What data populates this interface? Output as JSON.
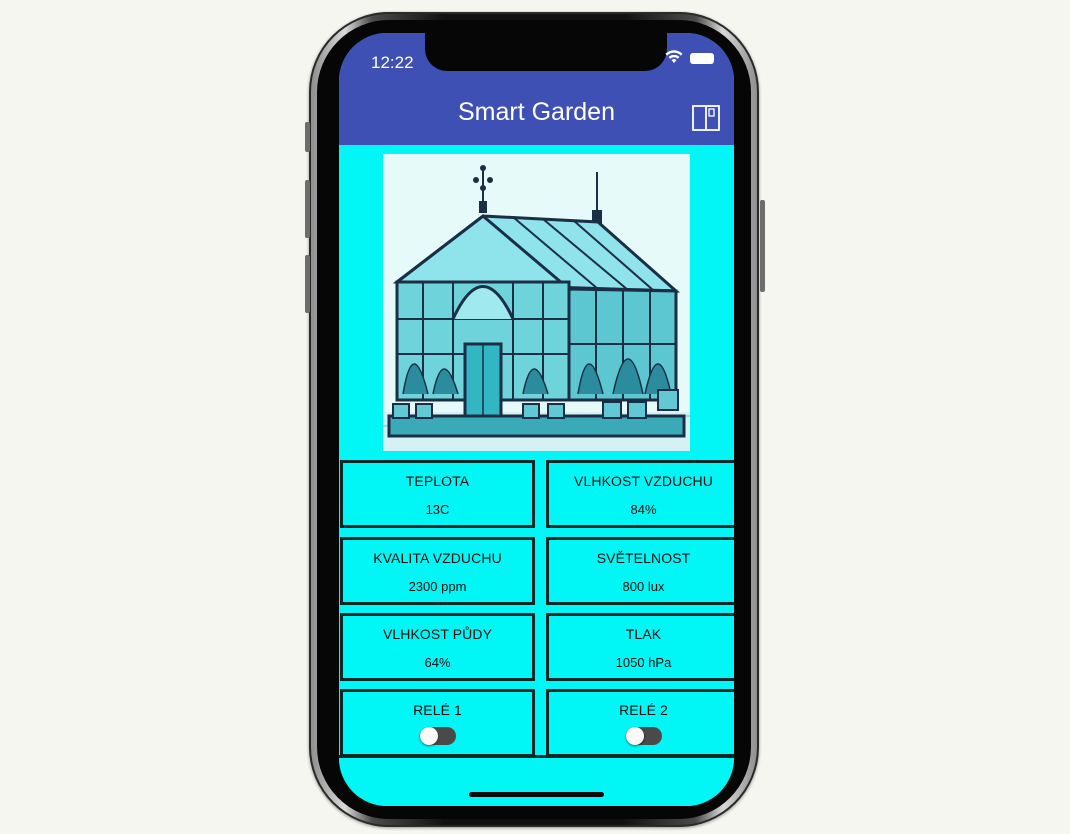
{
  "status_bar": {
    "time": "12:22"
  },
  "app_bar": {
    "title": "Smart Garden",
    "action_icon": "book-icon"
  },
  "hero_image": {
    "subject": "greenhouse-illustration"
  },
  "sensors": [
    {
      "label": "TEPLOTA",
      "value": "13C"
    },
    {
      "label": "VLHKOST VZDUCHU",
      "value": "84%"
    },
    {
      "label": "KVALITA VZDUCHU",
      "value": "2300 ppm"
    },
    {
      "label": "SVĚTELNOST",
      "value": "800 lux"
    },
    {
      "label": "VLHKOST PŮDY",
      "value": "64%"
    },
    {
      "label": "TLAK",
      "value": "1050 hPa"
    }
  ],
  "relays": [
    {
      "label": "RELÉ 1",
      "state": "off"
    },
    {
      "label": "RELÉ 2",
      "state": "off"
    }
  ],
  "colors": {
    "app_bar": "#3e50b4",
    "background": "#00f7f5",
    "border": "#062a2a"
  }
}
